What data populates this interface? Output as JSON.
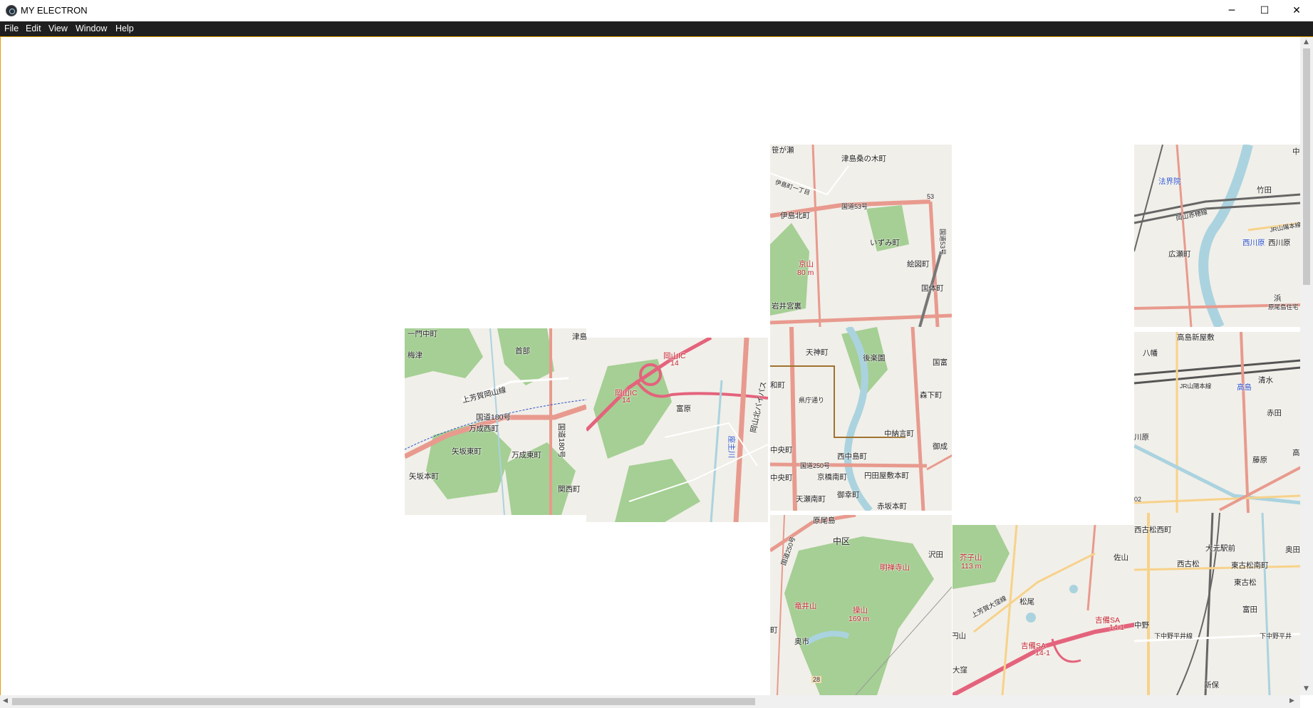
{
  "window": {
    "title": "MY ELECTRON",
    "controls": {
      "minimize": "─",
      "maximize": "☐",
      "close": "✕"
    }
  },
  "menu": [
    "File",
    "Edit",
    "View",
    "Window",
    "Help"
  ],
  "colors": {
    "land": "#f1efe9",
    "park": "#a5cf94",
    "water": "#aad3df",
    "major_road": "#e89a8e",
    "road": "#ffffff",
    "highway": "#e4637c"
  },
  "map": {
    "tiles": [
      {
        "name": "tile-northwest",
        "labels": [
          "一門中町",
          "梅津",
          "首部",
          "津島",
          "上芳賀岡山線",
          "国道180号",
          "万成西町",
          "矢坂東町",
          "万成東町",
          "矢坂本町",
          "関西町",
          "国道180号"
        ]
      },
      {
        "name": "tile-okayama-ic",
        "labels": [
          "岡山IC",
          "14",
          "岡山IC",
          "14",
          "富原",
          "岡山北バイパス",
          "座主川"
        ]
      },
      {
        "name": "tile-tsushima",
        "labels": [
          "笹が瀬",
          "津島桑の木町",
          "伊島町一丁目",
          "国道53号",
          "53",
          "伊島北町",
          "いずみ町",
          "京山",
          "80 m",
          "絵図町",
          "国体町",
          "岩井宮裏",
          "国道53号"
        ]
      },
      {
        "name": "tile-korakuen",
        "labels": [
          "天神町",
          "後楽園",
          "国富",
          "和町",
          "県庁通り",
          "森下町",
          "中納言町",
          "御成",
          "中央町",
          "西中島町",
          "国道250号",
          "中央町",
          "京橋南町",
          "円田屋敷本町",
          "天瀬南町",
          "御幸町",
          "赤坂本町"
        ]
      },
      {
        "name": "tile-misaoyama",
        "labels": [
          "原尾島",
          "中区",
          "国道250号",
          "沢田",
          "明禅寺山",
          "竜井山",
          "操山",
          "169 m",
          "奥市",
          "町",
          "28"
        ]
      },
      {
        "name": "tile-kibi-sa",
        "labels": [
          "芥子山",
          "113 m",
          "佐山",
          "松尾",
          "上芳賀大窪線",
          "円山",
          "大窪",
          "吉備SA",
          "14-1",
          "吉備SA",
          "14-1"
        ]
      },
      {
        "name": "tile-nishigawara",
        "labels": [
          "法界院",
          "竹田",
          "岡山赤穂線",
          "西川原",
          "西川原",
          "広瀬町",
          "浜",
          "原尾島住宅",
          "JR山陽本線",
          "中"
        ]
      },
      {
        "name": "tile-takashima",
        "labels": [
          "高島新屋敷",
          "八幡",
          "清水",
          "高島",
          "JR山陽本線",
          "赤田",
          "川原",
          "藤原",
          "高",
          "02"
        ]
      },
      {
        "name": "tile-saidaiji",
        "labels": [
          "西古松西町",
          "大元駅前",
          "奥田",
          "西古松",
          "東古松南町",
          "東古松",
          "富田",
          "中野",
          "下中野平井線",
          "下中野平井",
          "新保"
        ]
      }
    ]
  },
  "scrollbars": {
    "vertical": "vertical-scrollbar",
    "horizontal": "horizontal-scrollbar"
  }
}
